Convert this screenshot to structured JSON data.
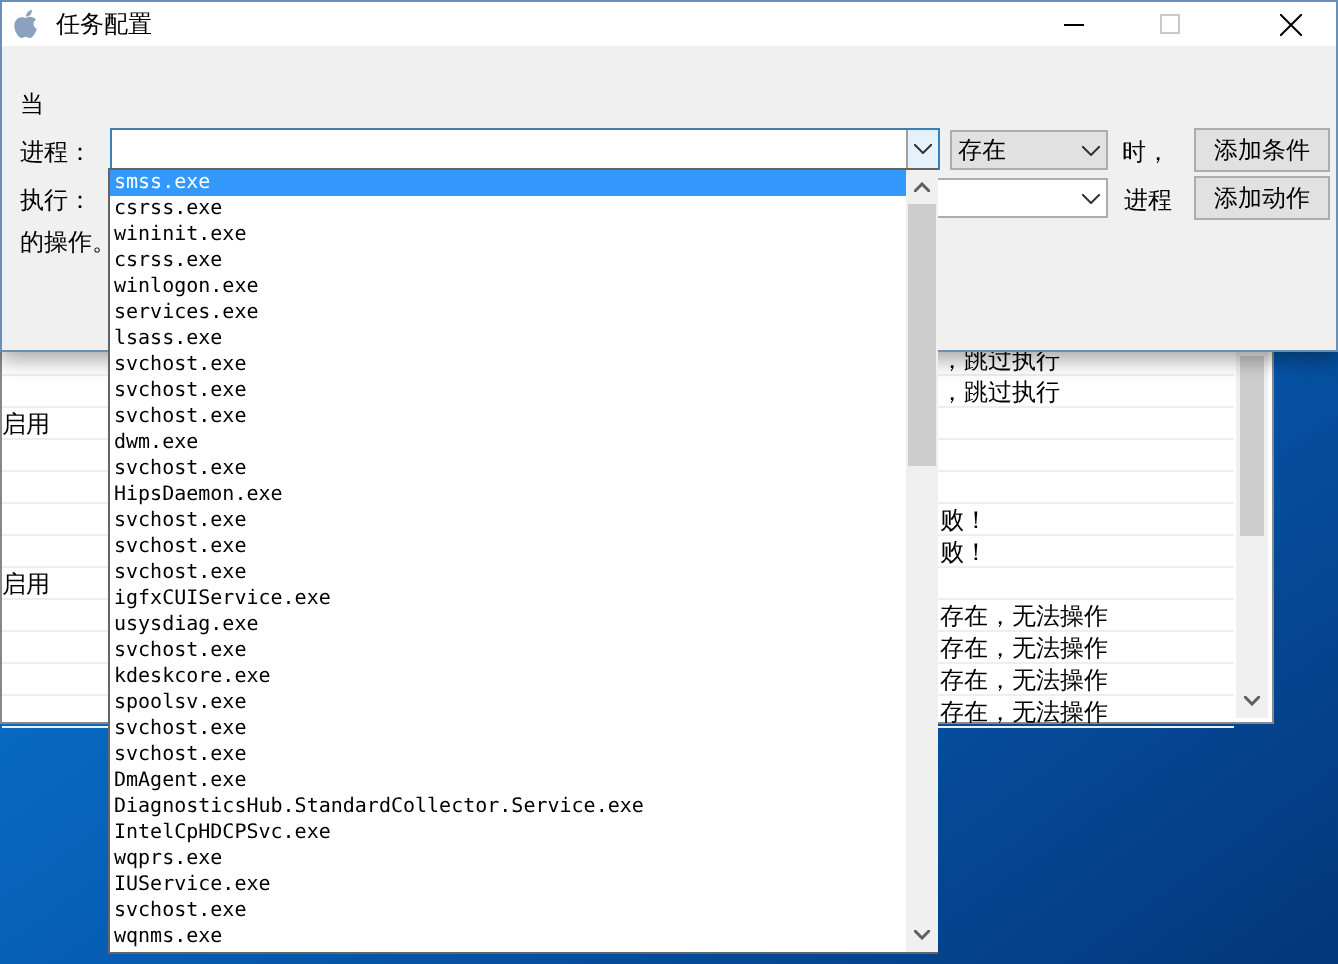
{
  "main_window": {
    "rows": [
      {
        "column_1": "",
        "column_2": "，跳过执行"
      },
      {
        "column_1": "",
        "column_2": "，跳过执行"
      },
      {
        "column_1": "启用",
        "column_2": ""
      },
      {
        "column_1": "",
        "column_2": ""
      },
      {
        "column_1": "",
        "column_2": ""
      },
      {
        "column_1": "",
        "column_2": "败！"
      },
      {
        "column_1": "",
        "column_2": "败！"
      },
      {
        "column_1": "启用",
        "column_2": ""
      },
      {
        "column_1": "",
        "column_2": "存在，无法操作"
      },
      {
        "column_1": "",
        "column_2": "存在，无法操作"
      },
      {
        "column_1": "",
        "column_2": "存在，无法操作"
      },
      {
        "column_1": "",
        "column_2": "存在，无法操作"
      }
    ]
  },
  "dialog": {
    "title": "任务配置",
    "maximize_disabled": true,
    "when_label": "当",
    "process_label": "进程：",
    "condition_select": "存在",
    "time_label": "时，",
    "add_condition_button": "添加条件",
    "execute_label": "执行：",
    "process_suffix": "进程",
    "add_action_button": "添加动作",
    "operation_label": "的操作。"
  },
  "process_dropdown": {
    "items": [
      {
        "label": "smss.exe",
        "selected": true
      },
      {
        "label": "csrss.exe",
        "selected": false
      },
      {
        "label": "wininit.exe",
        "selected": false
      },
      {
        "label": "csrss.exe",
        "selected": false
      },
      {
        "label": "winlogon.exe",
        "selected": false
      },
      {
        "label": "services.exe",
        "selected": false
      },
      {
        "label": "lsass.exe",
        "selected": false
      },
      {
        "label": "svchost.exe",
        "selected": false
      },
      {
        "label": "svchost.exe",
        "selected": false
      },
      {
        "label": "svchost.exe",
        "selected": false
      },
      {
        "label": "dwm.exe",
        "selected": false
      },
      {
        "label": "svchost.exe",
        "selected": false
      },
      {
        "label": "HipsDaemon.exe",
        "selected": false
      },
      {
        "label": "svchost.exe",
        "selected": false
      },
      {
        "label": "svchost.exe",
        "selected": false
      },
      {
        "label": "svchost.exe",
        "selected": false
      },
      {
        "label": "igfxCUIService.exe",
        "selected": false
      },
      {
        "label": "usysdiag.exe",
        "selected": false
      },
      {
        "label": "svchost.exe",
        "selected": false
      },
      {
        "label": "kdeskcore.exe",
        "selected": false
      },
      {
        "label": "spoolsv.exe",
        "selected": false
      },
      {
        "label": "svchost.exe",
        "selected": false
      },
      {
        "label": "svchost.exe",
        "selected": false
      },
      {
        "label": "DmAgent.exe",
        "selected": false
      },
      {
        "label": "DiagnosticsHub.StandardCollector.Service.exe",
        "selected": false
      },
      {
        "label": "IntelCpHDCPSvc.exe",
        "selected": false
      },
      {
        "label": "wqprs.exe",
        "selected": false
      },
      {
        "label": "IUService.exe",
        "selected": false
      },
      {
        "label": "svchost.exe",
        "selected": false
      },
      {
        "label": "wqnms.exe",
        "selected": false
      }
    ]
  }
}
